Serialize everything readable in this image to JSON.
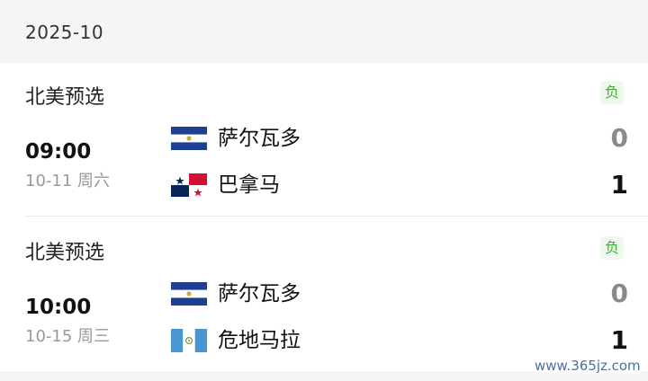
{
  "month_header": {
    "label": "2025-10"
  },
  "matches": [
    {
      "competition": "北美预选",
      "result_badge": "负",
      "time": "09:00",
      "date": "10-11  周六",
      "home": {
        "name": "萨尔瓦多",
        "score": "0",
        "flag": "el-salvador-flag"
      },
      "away": {
        "name": "巴拿马",
        "score": "1",
        "flag": "panama-flag"
      }
    },
    {
      "competition": "北美预选",
      "result_badge": "负",
      "time": "10:00",
      "date": "10-15  周三",
      "home": {
        "name": "萨尔瓦多",
        "score": "0",
        "flag": "el-salvador-flag"
      },
      "away": {
        "name": "危地马拉",
        "score": "1",
        "flag": "guatemala-flag"
      }
    }
  ],
  "watermark": "www.365jz.com",
  "colors": {
    "badge_text": "#3fae36",
    "badge_bg": "#eef8ec",
    "header_bg": "#f5f5f7",
    "loss_score": "#8a8a8a"
  }
}
